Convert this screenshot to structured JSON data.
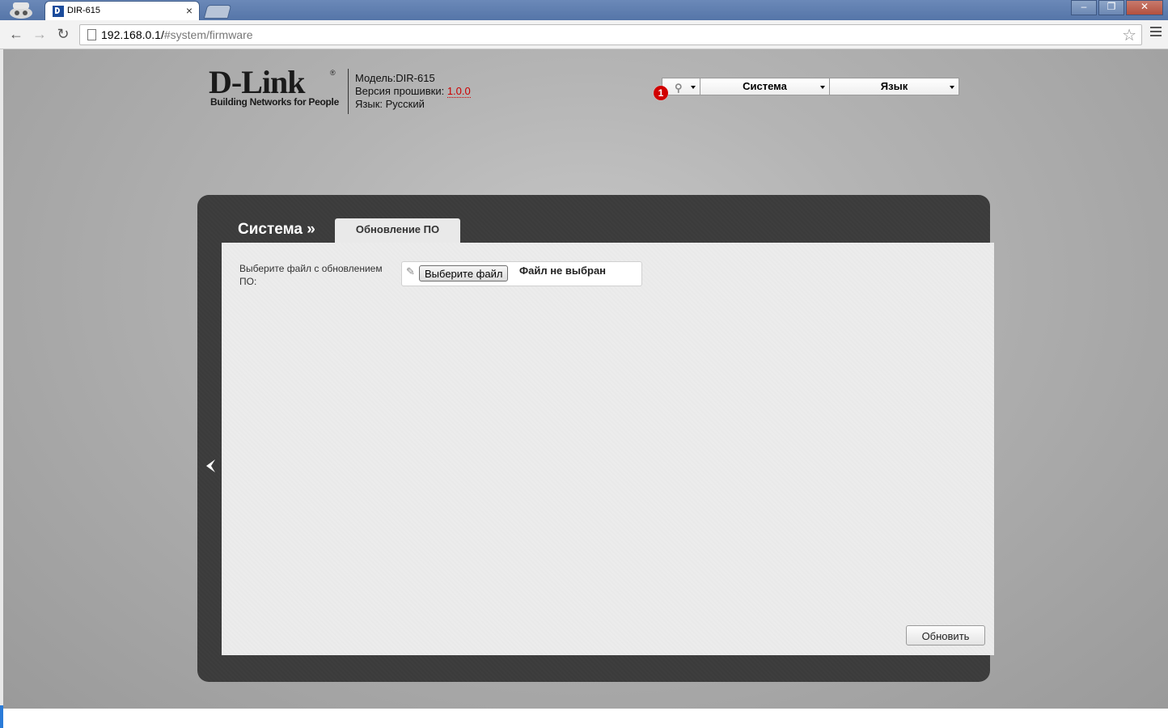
{
  "browser": {
    "tab_title": "DIR-615",
    "tab_close": "×",
    "url_host": "192.168.0.1/",
    "url_path": "#system/firmware",
    "window_buttons": [
      "–",
      "❐",
      "✕"
    ]
  },
  "header": {
    "logo_text": "D-Link",
    "logo_reg": "®",
    "logo_tagline": "Building Networks for People",
    "model_label": "Модель:",
    "model_value": "DIR-615",
    "firmware_label": "Версия прошивки:",
    "firmware_value": "1.0.0",
    "language_label": "Язык:",
    "language_value": "Русский"
  },
  "topnav": {
    "notification_count": "1",
    "items": [
      "Система",
      "Язык"
    ]
  },
  "content": {
    "breadcrumb": "Система »",
    "active_tab": "Обновление ПО",
    "file_label": "Выберите файл с обновлением ПО:",
    "choose_button": "Выберите файл",
    "file_status": "Файл не выбран",
    "update_button": "Обновить"
  },
  "colors": {
    "frame": "#3b3b3b",
    "panel": "#ececec",
    "badge": "#d10000",
    "firmware_link": "#cc0000"
  }
}
